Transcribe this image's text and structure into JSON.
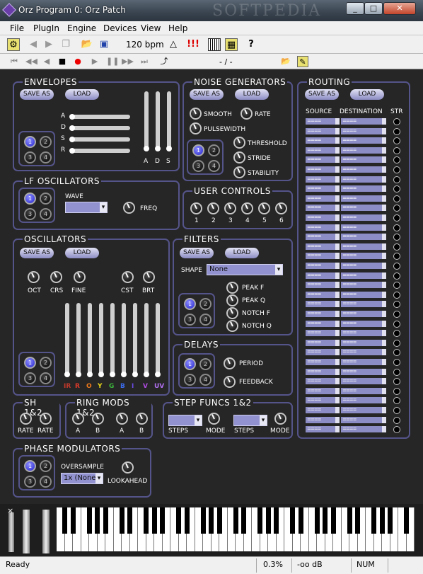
{
  "window": {
    "title": "Orz Program 0: Orz Patch",
    "watermark": "SOFTPEDIA",
    "controls": [
      "_",
      "□",
      "✕"
    ]
  },
  "menu": [
    "File",
    "PlugIn",
    "Engine",
    "Devices",
    "View",
    "Help"
  ],
  "toolbar": {
    "bpm": "120 bpm",
    "alert": "!!!",
    "help": "?"
  },
  "transport": {
    "position": "- / -"
  },
  "common": {
    "save_as": "SAVE AS",
    "load": "LOAD",
    "sel": [
      "1",
      "2",
      "3",
      "4"
    ]
  },
  "envelopes": {
    "title": "ENVELOPES",
    "rows": [
      "A",
      "D",
      "S",
      "R"
    ],
    "slider_labels": [
      "A",
      "D",
      "S"
    ]
  },
  "lfo": {
    "title": "LF OSCILLATORS",
    "wave": "WAVE",
    "freq": "FREQ"
  },
  "osc": {
    "title": "OSCILLATORS",
    "knobs": [
      "OCT",
      "CRS",
      "FINE",
      "CST",
      "BRT"
    ],
    "bars": [
      "IR",
      "R",
      "O",
      "Y",
      "G",
      "B",
      "I",
      "V",
      "UV"
    ],
    "bar_colors": [
      "#c0392b",
      "#e03a2a",
      "#f07a1a",
      "#e8d41a",
      "#3cb43c",
      "#3a6ae8",
      "#6a4ae0",
      "#b04ae0",
      "#b070f0"
    ]
  },
  "noise": {
    "title": "NOISE GENERATORS",
    "smooth": "SMOOTH",
    "rate": "RATE",
    "pulsewidth": "PULSEWIDTH",
    "threshold": "THRESHOLD",
    "stride": "STRIDE",
    "stability": "STABILITY"
  },
  "user": {
    "title": "USER CONTROLS",
    "knobs": [
      "1",
      "2",
      "3",
      "4",
      "5",
      "6"
    ]
  },
  "filters": {
    "title": "FILTERS",
    "shape_label": "SHAPE",
    "shape_value": "None",
    "knobs": [
      "PEAK F",
      "PEAK Q",
      "NOTCH F",
      "NOTCH Q"
    ]
  },
  "delays": {
    "title": "DELAYS",
    "period": "PERIOD",
    "feedback": "FEEDBACK"
  },
  "routing": {
    "title": "ROUTING",
    "source": "SOURCE",
    "destination": "DESTINATION",
    "str": "STR",
    "row_value": "===="
  },
  "sh": {
    "title": "SH 1&2",
    "knobs": [
      "RATE",
      "RATE"
    ]
  },
  "ring": {
    "title": "RING MODS 1&2",
    "knobs": [
      "A",
      "B",
      "A",
      "B"
    ]
  },
  "step": {
    "title": "STEP FUNCS 1&2",
    "steps": "STEPS",
    "mode": "MODE"
  },
  "phase": {
    "title": "PHASE MODULATORS",
    "oversample": "OVERSAMPLE",
    "oversample_value": "1x (None)",
    "lookahead": "LOOKAHEAD"
  },
  "keyboard": {
    "close": "×"
  },
  "status": {
    "ready": "Ready",
    "cpu": "0.3%",
    "level": "-oo dB",
    "num": "NUM"
  }
}
